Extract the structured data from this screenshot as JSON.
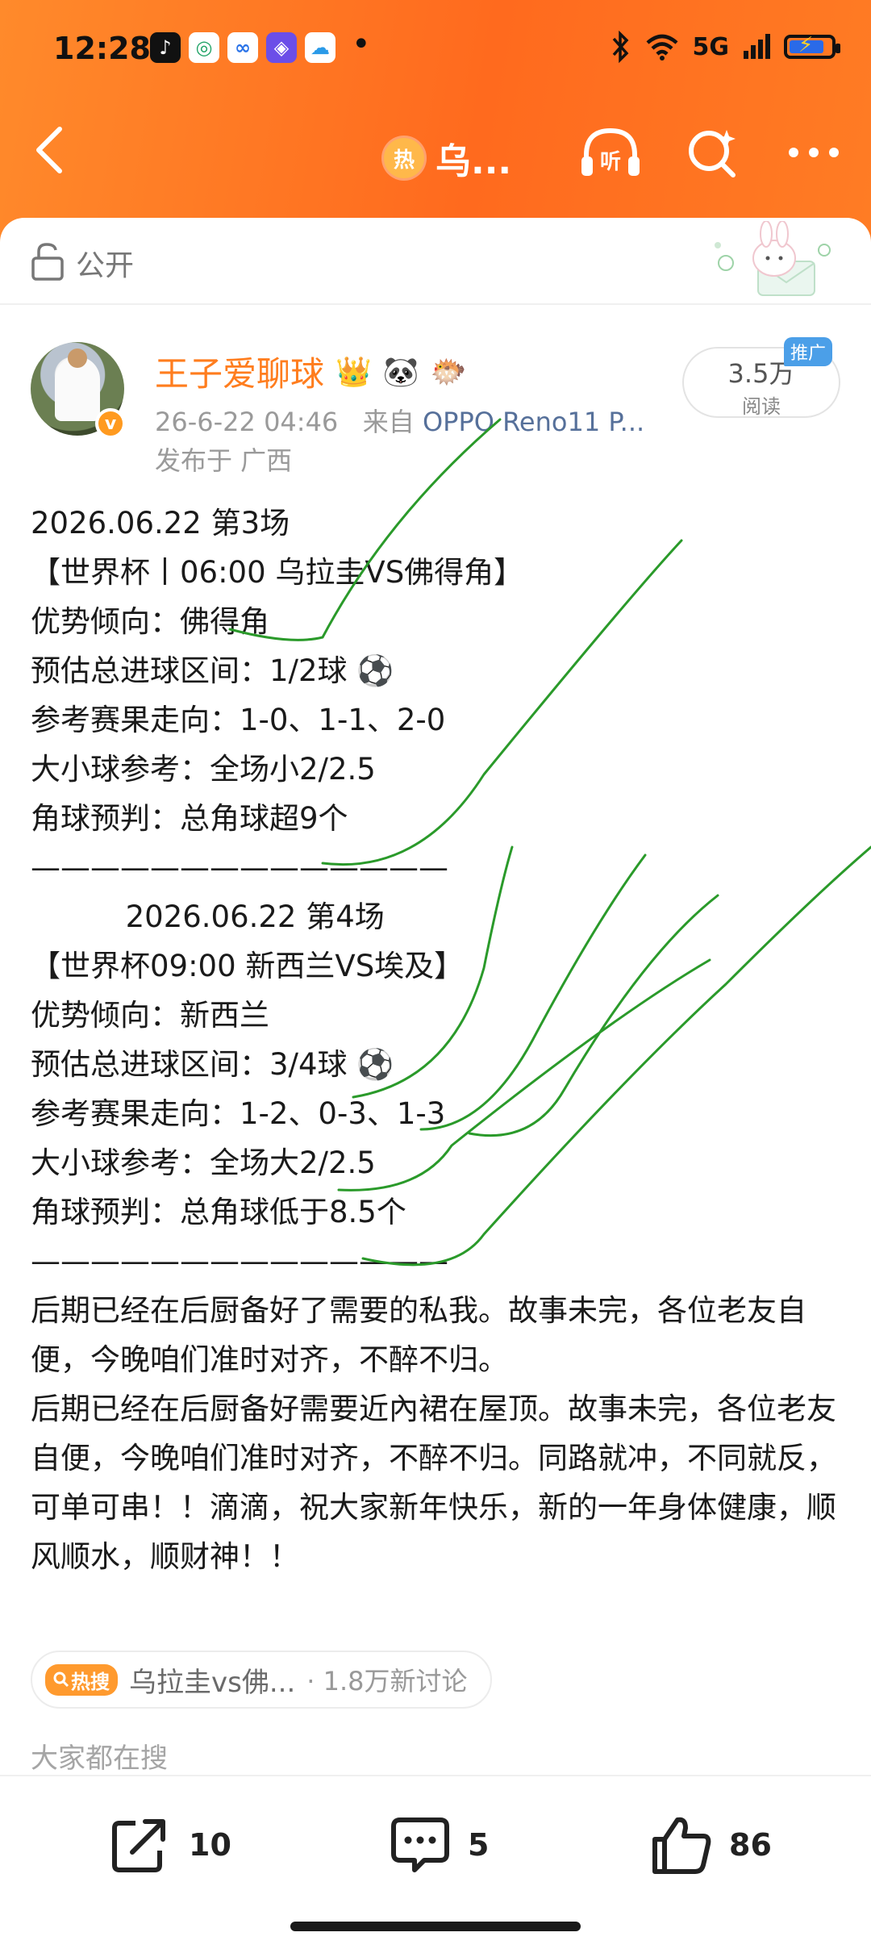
{
  "status_bar": {
    "time": "12:28",
    "app_icons": [
      "tiktok-icon",
      "wallet-icon",
      "baidu-cloud-icon",
      "shield-icon",
      "weather-icon"
    ],
    "network": "5G",
    "icons": [
      "bluetooth-icon",
      "wifi-icon",
      "signal-icon",
      "battery-charging-icon"
    ]
  },
  "nav": {
    "hot_label": "热",
    "title": "乌...",
    "listen_label": "听"
  },
  "visibility": {
    "label": "公开"
  },
  "author": {
    "name": "王子爱聊球",
    "verified_mark": "v",
    "badges": [
      "👑",
      "🐼",
      "🐡"
    ],
    "time": "26-6-22 04:46",
    "source_prefix": "来自",
    "device": "OPPO Reno11 P...",
    "location": "发布于 广西"
  },
  "reads": {
    "count": "3.5万",
    "label": "阅读",
    "ad_tag": "推广"
  },
  "post": {
    "lines": [
      "2026.06.22 第3场",
      "【世界杯丨06:00 乌拉圭VS佛得角】",
      "优势倾向：佛得角",
      "预估总进球区间：1/2球 ⚽",
      "参考赛果走向：1-0、1-1、2-0",
      "大小球参考：全场小2/2.5",
      "角球预判：总角球超9个",
      "——————————————",
      "          2026.06.22 第4场",
      "【世界杯09:00 新西兰VS埃及】",
      "优势倾向：新西兰",
      "预估总进球区间：3/4球 ⚽",
      "参考赛果走向：1-2、0-3、1-3",
      "大小球参考：全场大2/2.5",
      "角球预判：总角球低于8.5个",
      "——————————————"
    ],
    "paragraph1": "后期已经在后厨备好了需要的私我。故事未完，各位老友自便，今晚咱们准时对齐，不醉不归。",
    "paragraph2": " 后期已经在后厨备好需要近內裙在屋顶。故事未完，各位老友自便，今晚咱们准时对齐，不醉不归。同路就冲，不同就反，可单可串！！滴滴，祝大家新年快乐，新的一年身体健康，顺风顺水，顺财神！！"
  },
  "hot_search": {
    "tag": "热搜",
    "topic": "乌拉圭vs佛...",
    "count": "· 1.8万新讨论"
  },
  "everyone_search": "大家都在搜",
  "actions": {
    "share_count": "10",
    "comment_count": "5",
    "like_count": "86"
  },
  "colors": {
    "header": "#ff7a22",
    "username": "#ff7d1e",
    "annotation_ink": "#2a9a2a",
    "ad_tag": "#4b9fe8"
  }
}
